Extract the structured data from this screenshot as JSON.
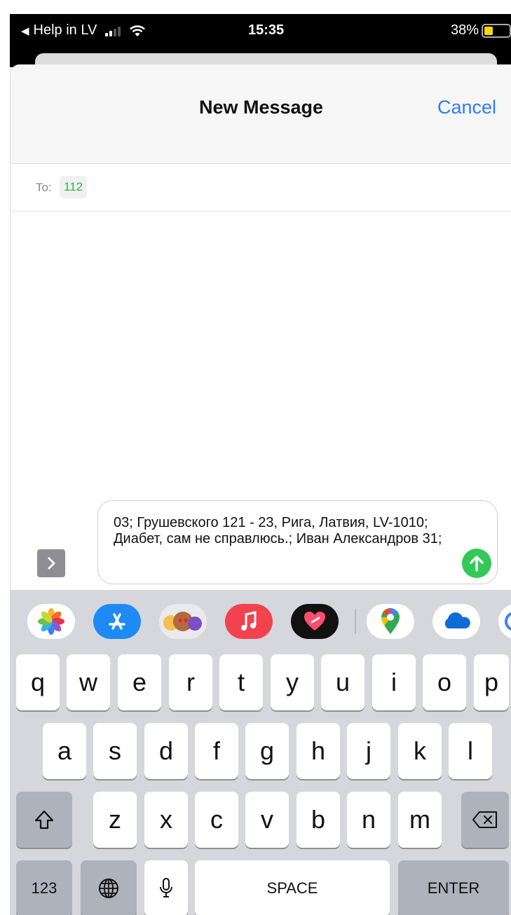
{
  "status_bar": {
    "back_app": "Help in LV",
    "time": "15:35",
    "battery": "38%",
    "signal_bars": 2,
    "battery_level": 0.38
  },
  "nav": {
    "title": "New Message",
    "cancel": "Cancel"
  },
  "recipients": {
    "label": "To:",
    "chip": "112"
  },
  "composer": {
    "text": "03; Грушевского 121 - 23, Рига, Латвия, LV-1010; Диабет, сам не справлюсь.; Иван Александров 31;"
  },
  "app_strip": [
    {
      "name": "photos-app-icon"
    },
    {
      "name": "app-store-icon"
    },
    {
      "name": "memoji-stickers-icon"
    },
    {
      "name": "music-app-icon"
    },
    {
      "name": "digital-touch-icon"
    },
    {
      "name": "google-maps-icon"
    },
    {
      "name": "onedrive-icon"
    }
  ],
  "keyboard": {
    "row1": [
      "q",
      "w",
      "e",
      "r",
      "t",
      "y",
      "u",
      "i",
      "o",
      "p"
    ],
    "row2": [
      "a",
      "s",
      "d",
      "f",
      "g",
      "h",
      "j",
      "k",
      "l"
    ],
    "row3": [
      "z",
      "x",
      "c",
      "v",
      "b",
      "n",
      "m"
    ],
    "numbers_key": "123",
    "space_key": "SPACE",
    "enter_key": "ENTER"
  },
  "colors": {
    "accent": "#2f7cf6",
    "send": "#34c759",
    "recipient": "#2db84c",
    "keyboard_bg": "#d5d7dc"
  }
}
